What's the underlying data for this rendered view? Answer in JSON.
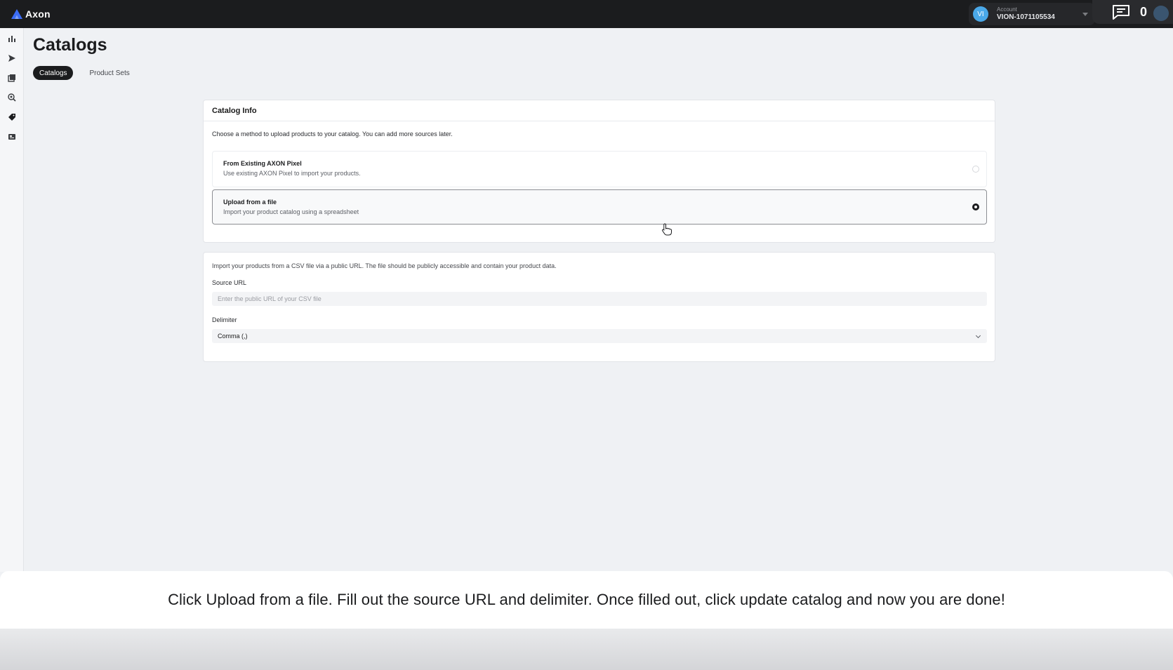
{
  "app": {
    "name": "Axon",
    "brand_color": "#3b6cf6"
  },
  "account": {
    "avatar_initials": "VI",
    "label": "Account",
    "id": "VION-1071105534"
  },
  "chat": {
    "count": "0"
  },
  "sidebar": {
    "items": [
      {
        "icon": "bar-chart-icon"
      },
      {
        "icon": "send-icon"
      },
      {
        "icon": "layers-icon"
      },
      {
        "icon": "search-target-icon"
      },
      {
        "icon": "tag-icon",
        "active": true
      },
      {
        "icon": "id-card-icon"
      }
    ]
  },
  "page": {
    "title": "Catalogs",
    "tabs": [
      {
        "label": "Catalogs",
        "active": true
      },
      {
        "label": "Product Sets",
        "active": false
      }
    ]
  },
  "catalog_info": {
    "header": "Catalog Info",
    "description": "Choose a method to upload products to your catalog. You can add more sources later.",
    "options": [
      {
        "title": "From Existing AXON Pixel",
        "subtitle": "Use existing AXON Pixel to import your products.",
        "selected": false
      },
      {
        "title": "Upload from a file",
        "subtitle": "Import your product catalog using a spreadsheet",
        "selected": true
      }
    ]
  },
  "upload": {
    "description": "Import your products from a CSV file via a public URL. The file should be publicly accessible and contain your product data.",
    "source_url": {
      "label": "Source URL",
      "placeholder": "Enter the public URL of your CSV file",
      "value": ""
    },
    "delimiter": {
      "label": "Delimiter",
      "value": "Comma (,)"
    }
  },
  "caption": "Click Upload from a file. Fill out the source URL and delimiter. Once filled out, click update catalog and now you are done!"
}
